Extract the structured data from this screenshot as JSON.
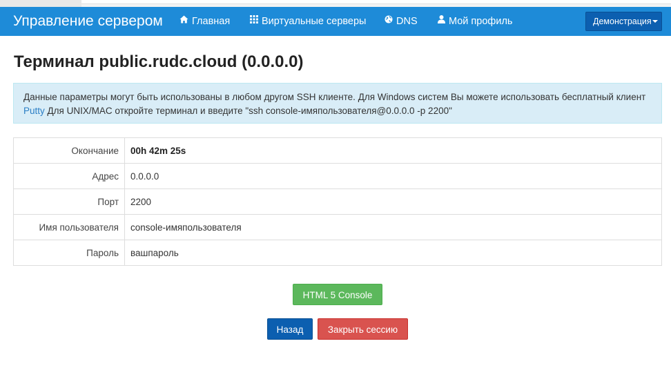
{
  "navbar": {
    "brand": "Управление сервером",
    "items": [
      {
        "label": "Главная",
        "icon": "home-icon"
      },
      {
        "label": "Виртуальные серверы",
        "icon": "grid-icon"
      },
      {
        "label": "DNS",
        "icon": "globe-icon"
      },
      {
        "label": "Мой профиль",
        "icon": "user-icon"
      }
    ],
    "account_dropdown": "Демонстрация"
  },
  "page": {
    "title": "Терминал public.rudc.cloud (0.0.0.0)"
  },
  "alert": {
    "text_before_link": "Данные параметры могут быть использованы в любом другом SSH клиенте. Для Windows систем Вы можете использовать бесплатный клиент ",
    "link_text": "Putty",
    "text_after_link": " Для UNIX/MAC откройте терминал и введите \"ssh console-имяпользователя@0.0.0.0 -p 2200\""
  },
  "details": {
    "rows": [
      {
        "label": "Окончание",
        "value": "00h 42m 25s"
      },
      {
        "label": "Адрес",
        "value": "0.0.0.0"
      },
      {
        "label": "Порт",
        "value": "2200"
      },
      {
        "label": "Имя пользователя",
        "value": "console-имяпользователя"
      },
      {
        "label": "Пароль",
        "value": "вашпароль"
      }
    ]
  },
  "actions": {
    "console_button": "HTML 5 Console",
    "back_button": "Назад",
    "close_session_button": "Закрыть сессию"
  },
  "colors": {
    "navbar": "#1e8bd8",
    "primary": "#0c5fb0",
    "success": "#5cb85c",
    "danger": "#d9534f",
    "info_bg": "#d9edf7",
    "link": "#2a7ec5"
  }
}
